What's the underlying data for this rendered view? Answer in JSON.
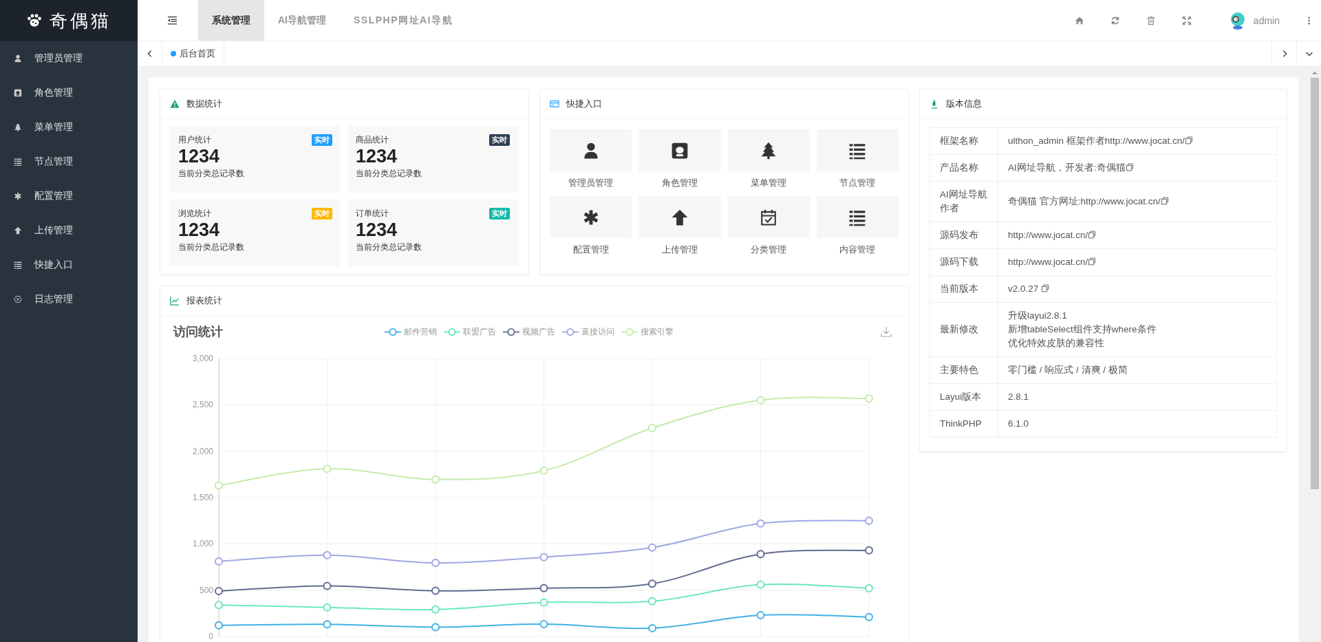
{
  "logo": {
    "text": "奇偶猫"
  },
  "header": {
    "tabs": [
      {
        "label": "系统管理",
        "selected": true
      },
      {
        "label": "AI导航管理",
        "selected": false
      },
      {
        "label": "SSLPHP网址AI导航",
        "selected": false
      }
    ],
    "user": {
      "name": "admin"
    }
  },
  "sidebar": {
    "items": [
      {
        "label": "管理员管理"
      },
      {
        "label": "角色管理"
      },
      {
        "label": "菜单管理"
      },
      {
        "label": "节点管理"
      },
      {
        "label": "配置管理"
      },
      {
        "label": "上传管理"
      },
      {
        "label": "快捷入口"
      },
      {
        "label": "日志管理"
      }
    ]
  },
  "page_tabs": [
    {
      "label": "后台首页",
      "selected": true
    }
  ],
  "stats": {
    "title": "数据统计",
    "cards": [
      {
        "label": "用户统计",
        "badge": "实时",
        "color": "#1e9fff",
        "value": "1234",
        "note": "当前分类总记录数"
      },
      {
        "label": "商品统计",
        "badge": "实时",
        "color": "#2f4056",
        "value": "1234",
        "note": "当前分类总记录数"
      },
      {
        "label": "浏览统计",
        "badge": "实时",
        "color": "#ffb800",
        "value": "1234",
        "note": "当前分类总记录数"
      },
      {
        "label": "订单统计",
        "badge": "实时",
        "color": "#16baaa",
        "value": "1234",
        "note": "当前分类总记录数"
      }
    ]
  },
  "quick": {
    "title": "快捷入口",
    "items": [
      {
        "label": "管理员管理"
      },
      {
        "label": "角色管理"
      },
      {
        "label": "菜单管理"
      },
      {
        "label": "节点管理"
      },
      {
        "label": "配置管理"
      },
      {
        "label": "上传管理"
      },
      {
        "label": "分类管理"
      },
      {
        "label": "内容管理"
      }
    ]
  },
  "report": {
    "title": "报表统计",
    "chart_title": "访问统计",
    "chart_data": {
      "type": "line",
      "grid": true,
      "ylim": [
        0,
        3000
      ],
      "yticks": [
        {
          "value": 0,
          "label": "0"
        },
        {
          "value": 500,
          "label": "500"
        },
        {
          "value": 1000,
          "label": "1,000"
        },
        {
          "value": 1500,
          "label": "1,500"
        },
        {
          "value": 2000,
          "label": "2,000"
        },
        {
          "value": 2500,
          "label": "2,500"
        },
        {
          "value": 3000,
          "label": "3,000"
        }
      ],
      "series": [
        {
          "name": "邮件营销",
          "color": "#3fb1e3",
          "marker": "circle",
          "values": [
            120,
            132,
            101,
            134,
            90,
            230,
            210
          ]
        },
        {
          "name": "联盟广告",
          "color": "#6be6c1",
          "marker": "circle",
          "values": [
            340,
            314,
            292,
            368,
            380,
            560,
            520
          ]
        },
        {
          "name": "视频广告",
          "color": "#626c91",
          "marker": "circle",
          "values": [
            490,
            546,
            493,
            522,
            570,
            890,
            930
          ]
        },
        {
          "name": "直接访问",
          "color": "#a0a7e6",
          "marker": "circle",
          "values": [
            810,
            878,
            794,
            856,
            960,
            1220,
            1250
          ]
        },
        {
          "name": "搜索引擎",
          "color": "#c4ebad",
          "marker": "circle",
          "values": [
            1630,
            1810,
            1695,
            1790,
            2250,
            2550,
            2570
          ]
        }
      ]
    }
  },
  "version": {
    "title": "版本信息",
    "rows": [
      {
        "label": "框架名称",
        "lines": [
          "ulthon_admin 框架作者http://www.jocat.cn/"
        ],
        "copyable": true
      },
      {
        "label": "产品名称",
        "lines": [
          "AI网址导航，开发者:奇偶猫"
        ],
        "copyable": true
      },
      {
        "label": "AI网址导航作者",
        "lines": [
          "奇偶猫 官方网址:http://www.jocat.cn/"
        ],
        "copyable": true
      },
      {
        "label": "源码发布",
        "lines": [
          "http://www.jocat.cn/"
        ],
        "copyable": true
      },
      {
        "label": "源码下载",
        "lines": [
          "http://www.jocat.cn/"
        ],
        "copyable": true
      },
      {
        "label": "当前版本",
        "lines": [
          "v2.0.27 "
        ],
        "copyable": true
      },
      {
        "label": "最新修改",
        "lines": [
          "升级layui2.8.1",
          "新增tableSelect组件支持where条件",
          "优化特效皮肤的兼容性"
        ],
        "copyable": false
      },
      {
        "label": "主要特色",
        "lines": [
          "零门槛 / 响应式 / 清爽 / 极简"
        ],
        "copyable": false
      },
      {
        "label": "Layui版本",
        "lines": [
          "2.8.1"
        ],
        "copyable": false
      },
      {
        "label": "ThinkPHP",
        "lines": [
          "6.1.0"
        ],
        "copyable": false
      }
    ]
  }
}
